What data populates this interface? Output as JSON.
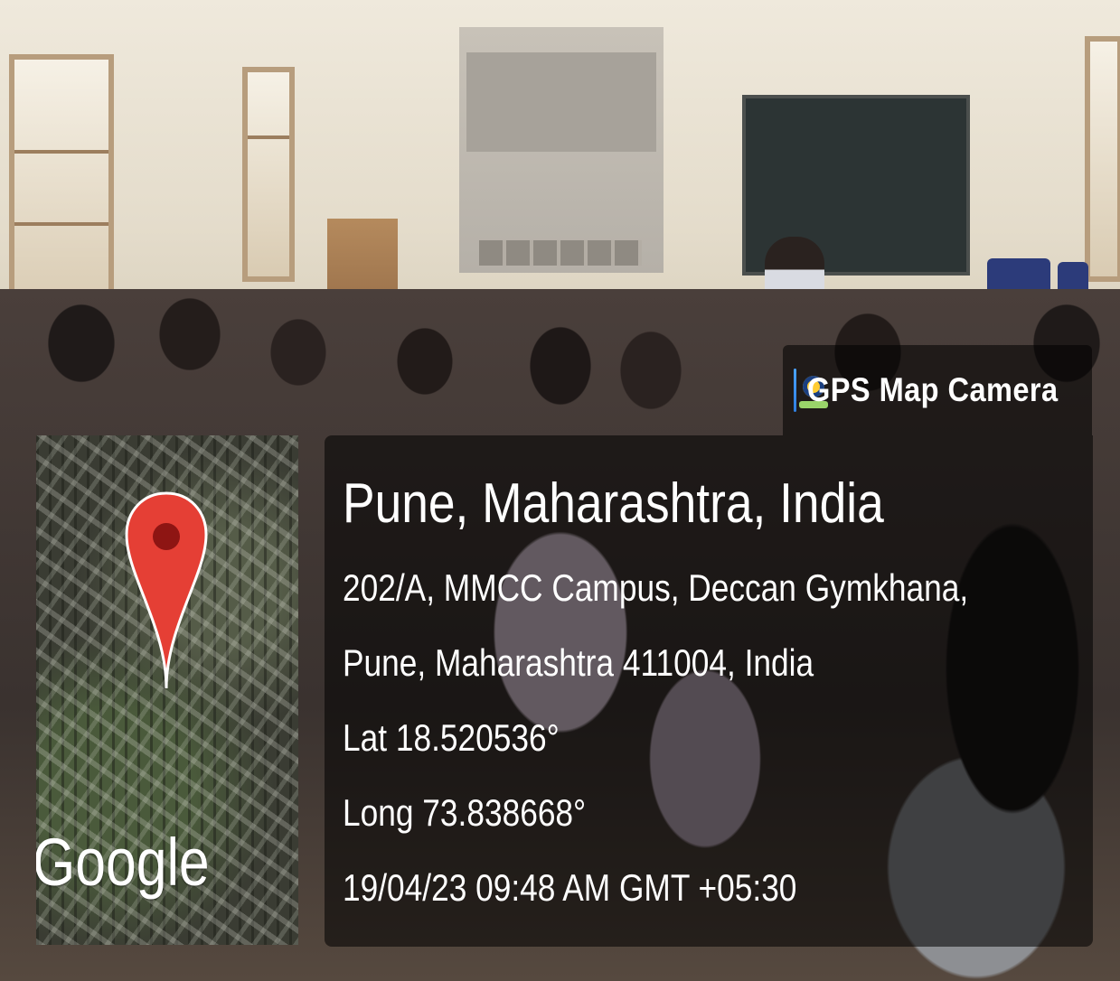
{
  "watermark": {
    "app_name": "GPS Map Camera",
    "app_icon": "gps-map-camera-icon"
  },
  "location": {
    "title": "Pune, Maharashtra, India",
    "address_line_1": "202/A, MMCC Campus, Deccan Gymkhana,",
    "address_line_2": "Pune, Maharashtra 411004, India",
    "latitude": "Lat 18.520536°",
    "longitude": "Long 73.838668°",
    "datetime": "19/04/23 09:48 AM GMT +05:30"
  },
  "minimap": {
    "provider_logo": "Google",
    "marker_icon": "map-pin-icon",
    "marker_color": "#e53f35"
  }
}
